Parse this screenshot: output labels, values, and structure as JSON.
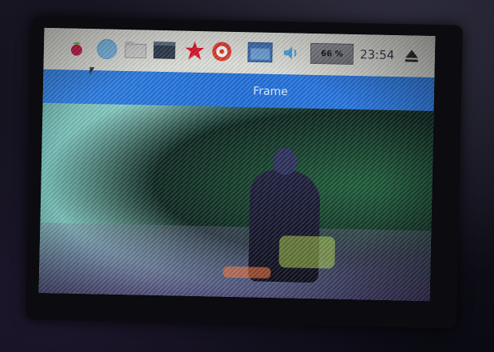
{
  "taskbar": {
    "icons": [
      "raspberry-icon",
      "globe-icon",
      "folder-icon",
      "terminal-icon",
      "math-icon",
      "wolfram-icon",
      "window-icon",
      "volume-icon",
      "eject-icon"
    ],
    "cpu_label": "66 %",
    "clock": "23:54"
  },
  "window": {
    "title": "Frame"
  },
  "colors": {
    "title_bar": "#2a76e0",
    "taskbar": "#e3e4df"
  }
}
